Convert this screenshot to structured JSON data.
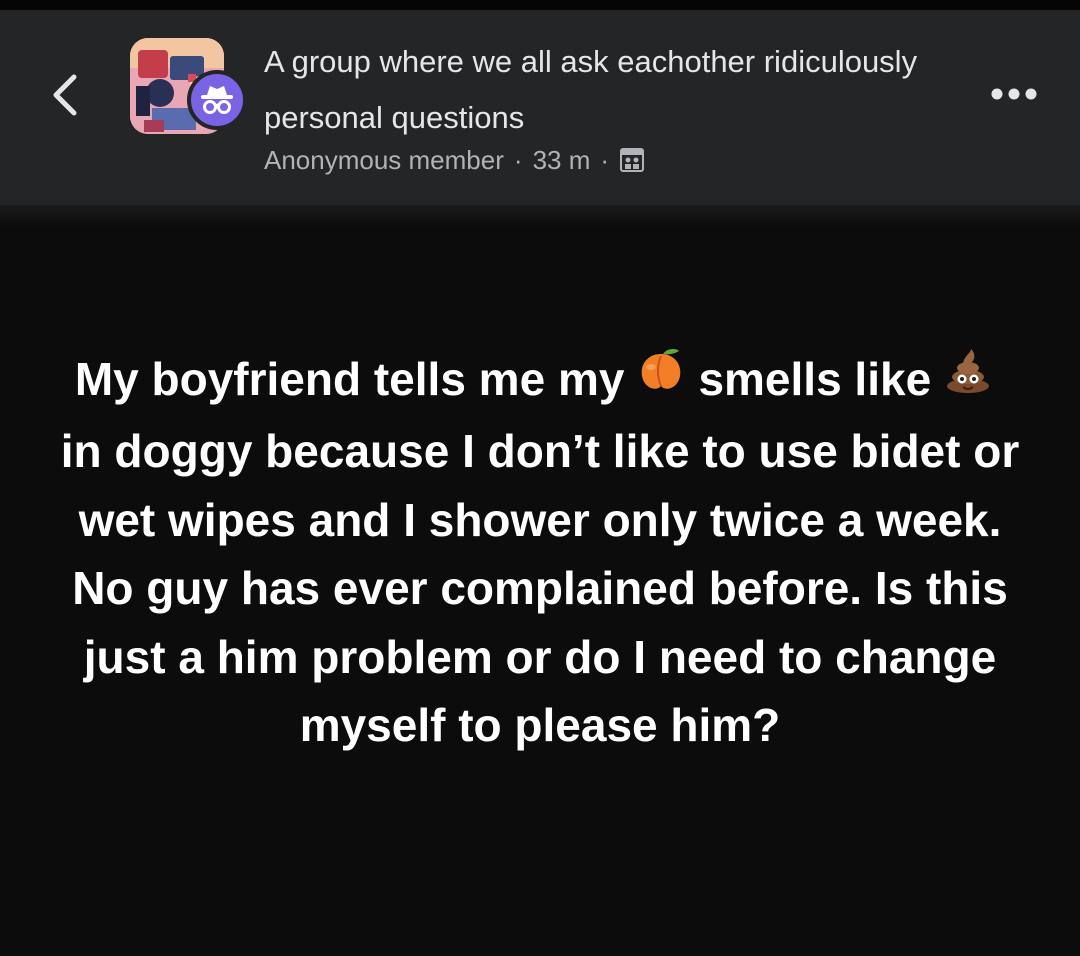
{
  "header": {
    "back_icon": "chevron-left-icon",
    "group_name": "A group where we all ask eachother ridiculously personal questions",
    "author": "Anonymous member",
    "separator": "·",
    "time": "33 m",
    "privacy_icon": "group-privacy-icon",
    "more_icon": "more-horizontal-icon"
  },
  "post": {
    "part1": "My boyfriend tells me my",
    "emoji1": "peach-emoji",
    "part2": "smells like",
    "emoji2": "poop-emoji",
    "part3": "in doggy because I don’t like to use bidet or wet wipes and I shower only twice a week. No guy has ever complained before. Is this just a him problem or do I need to change myself to please him?"
  },
  "colors": {
    "header_bg": "#242526",
    "page_bg": "#0c0c0d",
    "primary_text": "#e4e6eb",
    "secondary_text": "#b0b3b8",
    "anon_badge": "#7b63e6"
  }
}
